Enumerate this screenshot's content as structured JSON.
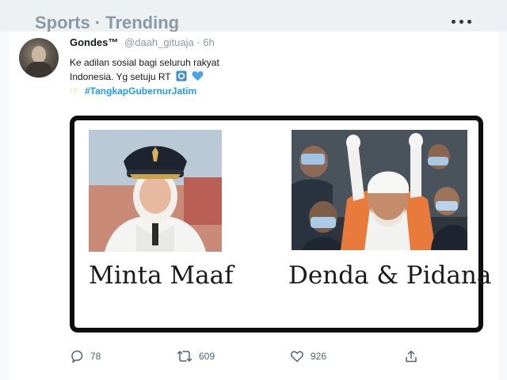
{
  "trending": {
    "title": "Sports · Trending"
  },
  "tweet": {
    "name": "Gondes™",
    "handle": "@daah_gituaja · 6h",
    "text_line1": "Ke adilan sosial bagi seluruh rakyat",
    "text_line2": "Indonesia. Yg setuju RT",
    "hashtag": "#TangkapGubernurJatim",
    "media": {
      "caption_left": "Minta Maaf",
      "caption_right": "Denda & Pidana"
    },
    "stats": {
      "replies": "78",
      "retweets": "609",
      "likes": "926"
    }
  },
  "icons": {
    "more": "more-horizontal-icon",
    "reply": "reply-icon",
    "retweet": "retweet-icon",
    "like": "heart-icon",
    "share": "share-icon",
    "pointer": "pointing-hand-icon",
    "blue_square": "blue-square-icon",
    "blue_heart": "blue-heart-icon"
  },
  "colors": {
    "accent": "#1d9bf0",
    "muted": "#8b98a5",
    "frame": "#0d0d0d"
  }
}
